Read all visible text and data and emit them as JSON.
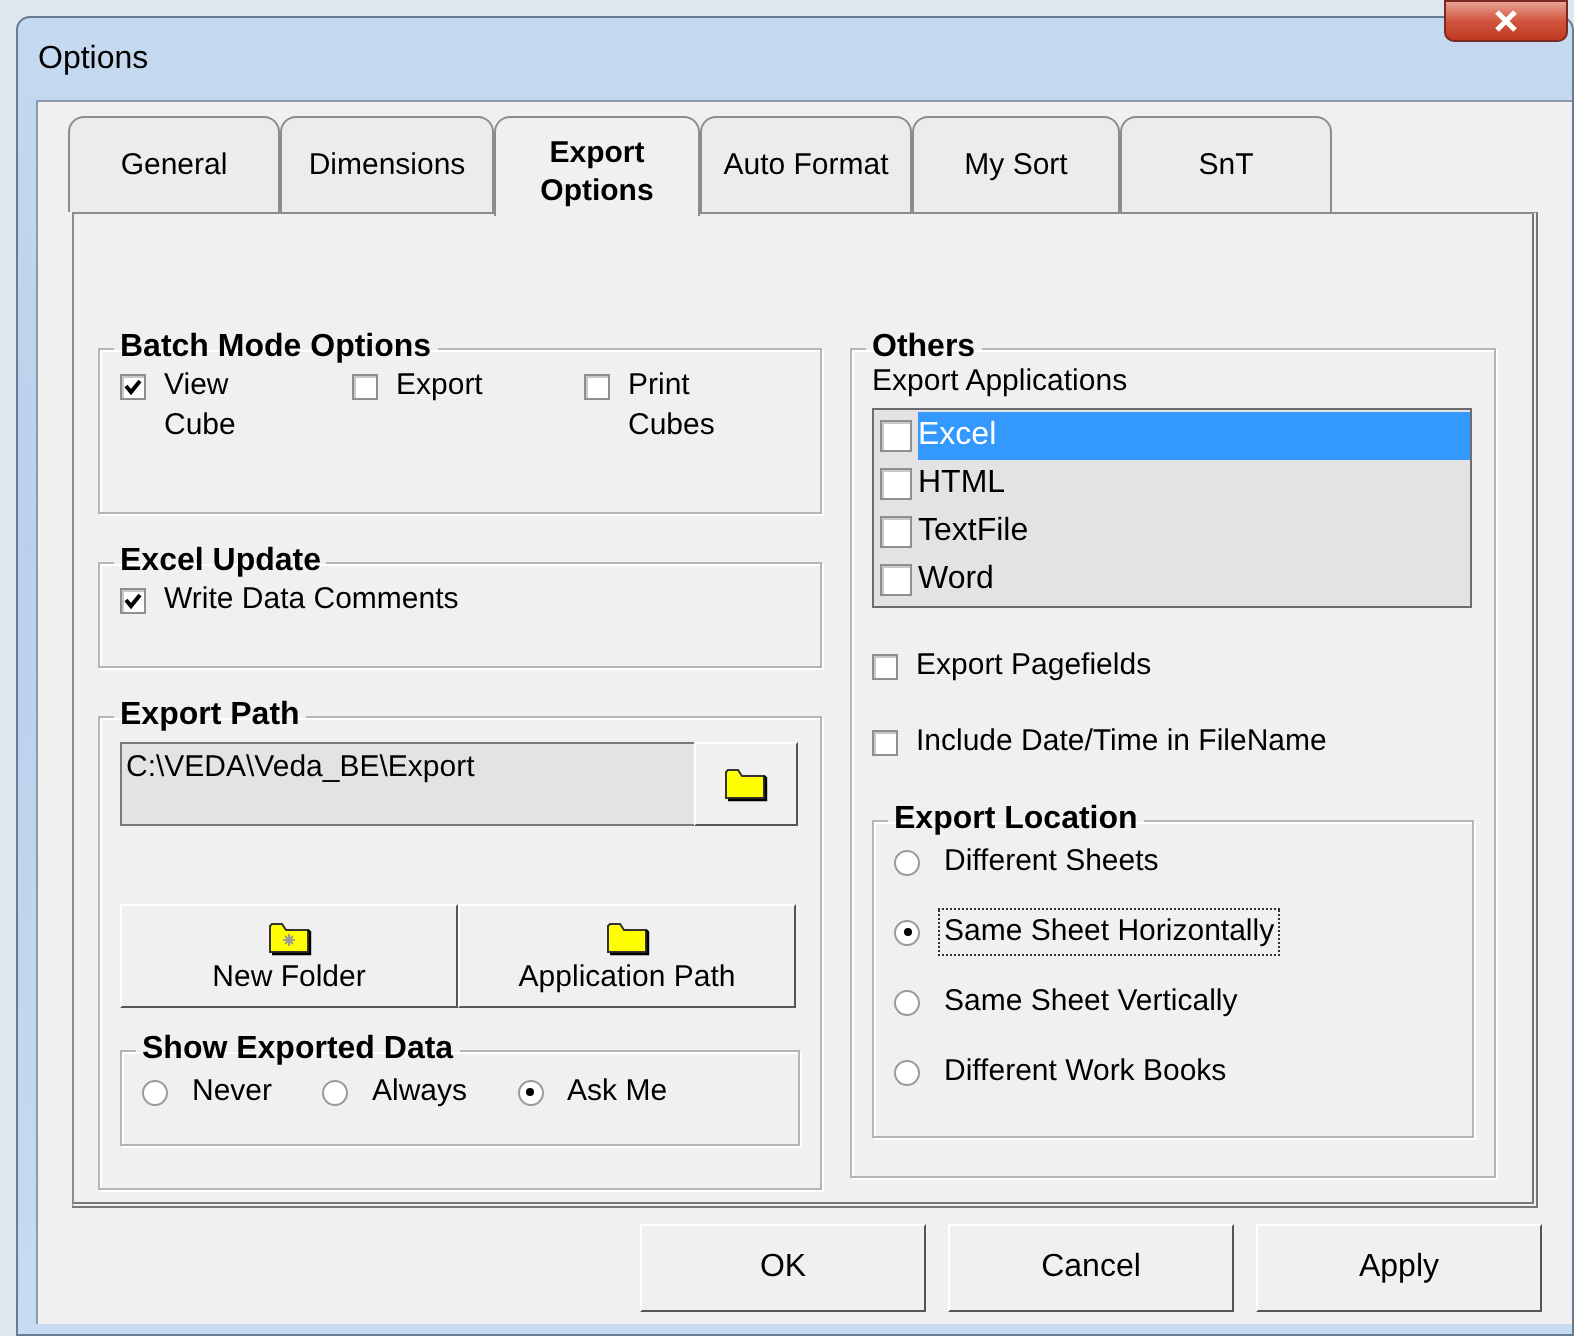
{
  "window": {
    "title": "Options"
  },
  "tabs": [
    {
      "label": "General",
      "selected": false
    },
    {
      "label": "Dimensions",
      "selected": false
    },
    {
      "label": "Export Options",
      "selected": true
    },
    {
      "label": "Auto Format",
      "selected": false
    },
    {
      "label": "My Sort",
      "selected": false
    },
    {
      "label": "SnT",
      "selected": false
    }
  ],
  "batch_mode_options": {
    "title": "Batch Mode Options",
    "items": [
      {
        "label": "View Cube",
        "checked": true
      },
      {
        "label": "Export",
        "checked": false
      },
      {
        "label": "Print Cubes",
        "checked": false
      }
    ]
  },
  "excel_update": {
    "title": "Excel Update",
    "items": [
      {
        "label": "Write Data Comments",
        "checked": true
      }
    ]
  },
  "export_path": {
    "title": "Export Path",
    "value": "C:\\VEDA\\Veda_BE\\Export",
    "buttons": [
      {
        "label": "New Folder",
        "kind": "new"
      },
      {
        "label": "Application Path",
        "kind": "open"
      }
    ]
  },
  "show_exported_data": {
    "title": "Show Exported Data",
    "options": [
      {
        "label": "Never",
        "selected": false
      },
      {
        "label": "Always",
        "selected": false
      },
      {
        "label": "Ask Me",
        "selected": true
      }
    ]
  },
  "others": {
    "title": "Others",
    "list_label": "Export Applications",
    "applications": [
      {
        "label": "Excel",
        "checked": false,
        "selected": true
      },
      {
        "label": "HTML",
        "checked": false,
        "selected": false
      },
      {
        "label": "TextFile",
        "checked": false,
        "selected": false
      },
      {
        "label": "Word",
        "checked": false,
        "selected": false
      }
    ],
    "options": [
      {
        "label": "Export Pagefields",
        "checked": false
      },
      {
        "label": "Include Date/Time in FileName",
        "checked": false
      }
    ]
  },
  "export_location": {
    "title": "Export Location",
    "options": [
      {
        "label": "Different Sheets",
        "selected": false
      },
      {
        "label": "Same Sheet Horizontally",
        "selected": true
      },
      {
        "label": "Same Sheet Vertically",
        "selected": false
      },
      {
        "label": "Different Work Books",
        "selected": false
      }
    ]
  },
  "buttons": [
    {
      "label": "OK"
    },
    {
      "label": "Cancel"
    },
    {
      "label": "Apply"
    }
  ]
}
